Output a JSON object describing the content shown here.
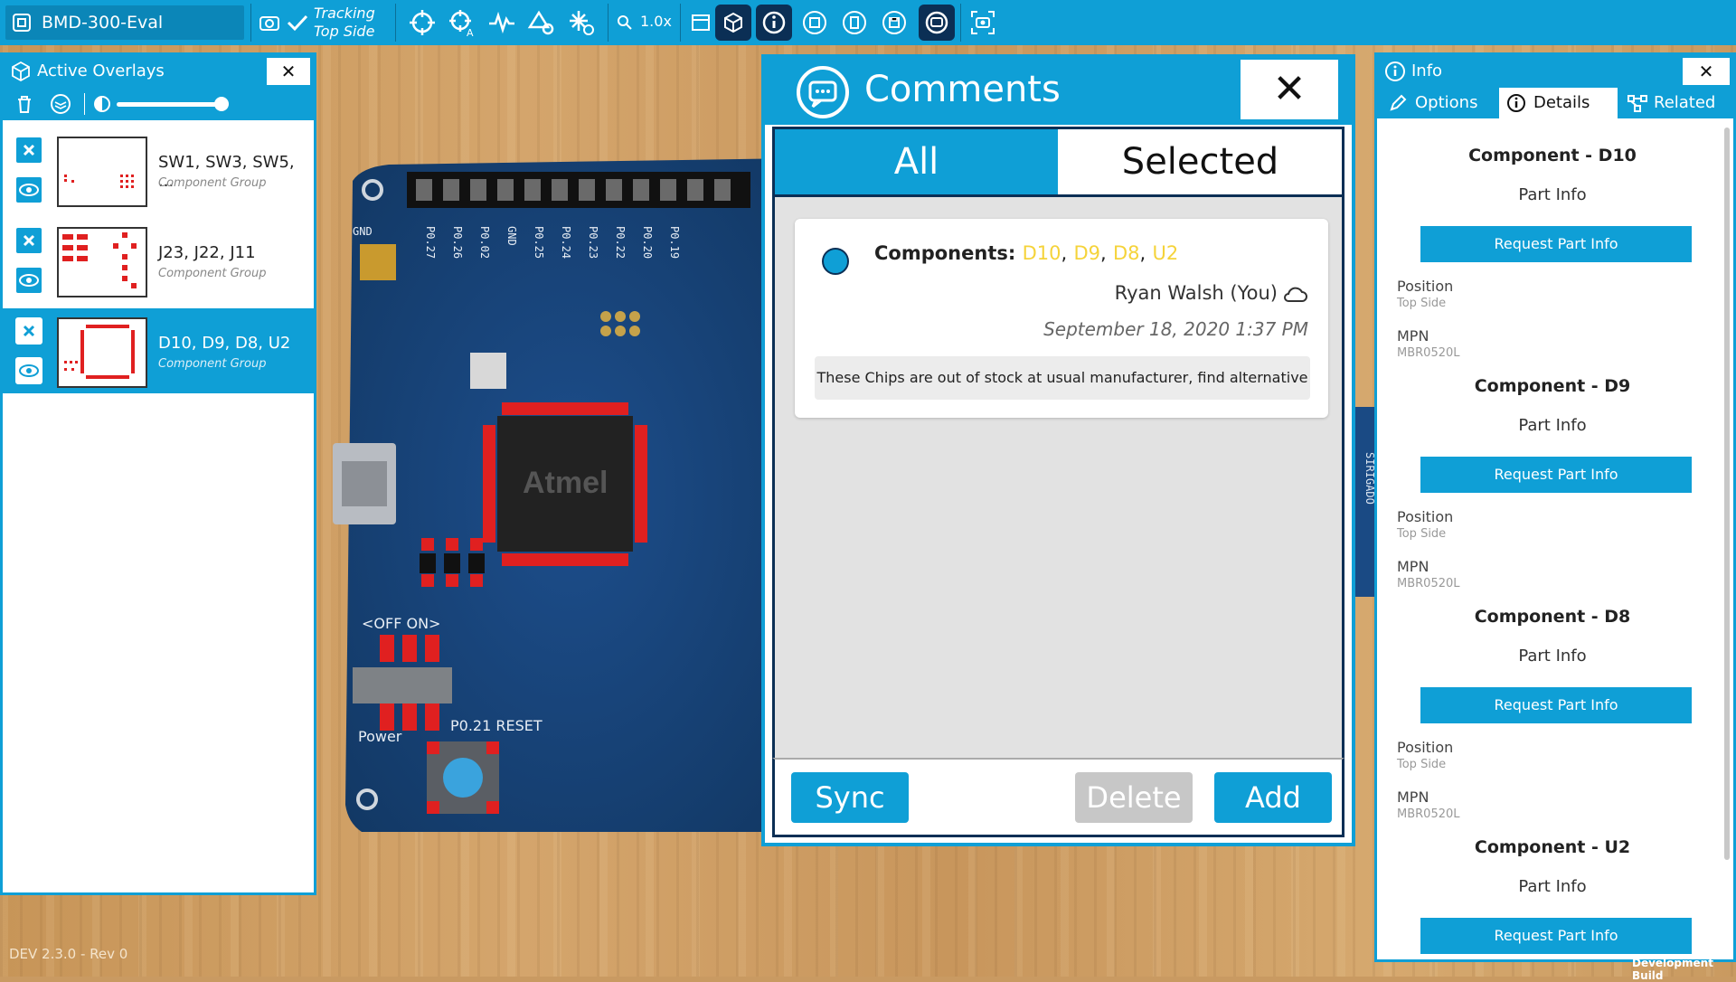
{
  "toolbar": {
    "project_name": "BMD-300-Eval",
    "tracking_line1": "Tracking",
    "tracking_line2": "Top Side",
    "zoom": "1.0x",
    "icons": [
      "board-icon",
      "camera-rotate-icon",
      "check-icon",
      "crosshair-icon",
      "crosshair-a-icon",
      "signal-icon",
      "shapes-search-icon",
      "snowflake-search-icon",
      "zoom-icon",
      "window-icon",
      "cube-icon",
      "info-icon",
      "part-icon",
      "doc-icon",
      "save-icon",
      "comment-icon",
      "screenshot-icon"
    ]
  },
  "overlays": {
    "title": "Active Overlays",
    "close": "✕",
    "items": [
      {
        "name": "SW1, SW3, SW5, ...",
        "type": "Component Group",
        "selected": false
      },
      {
        "name": "J23, J22, J11",
        "type": "Component Group",
        "selected": false
      },
      {
        "name": "D10, D9, D8, U2",
        "type": "Component Group",
        "selected": true
      }
    ]
  },
  "board_labels": {
    "gnd": "GND",
    "pins": [
      "P0.27",
      "P0.26",
      "P0.02",
      "GND",
      "P0.25",
      "P0.24",
      "P0.23",
      "P0.22",
      "P0.20",
      "P0.19"
    ],
    "chip": "Atmel",
    "off_on": "<OFF ON>",
    "power": "Power",
    "reset": "P0.21 RESET",
    "side_text": "SIRIGADO"
  },
  "comments": {
    "title": "Comments",
    "close": "✕",
    "tabs": {
      "all": "All",
      "selected": "Selected"
    },
    "entry": {
      "components_label": "Components:",
      "components": [
        "D10",
        "D9",
        "D8",
        "U2"
      ],
      "author": "Ryan Walsh (You)",
      "timestamp": "September 18, 2020 1:37 PM",
      "text": "These Chips are out of stock at usual manufacturer, find alternative"
    },
    "buttons": {
      "sync": "Sync",
      "delete": "Delete",
      "add": "Add"
    }
  },
  "info": {
    "title": "Info",
    "close": "✕",
    "tabs": {
      "options": "Options",
      "details": "Details",
      "related": "Related"
    },
    "part_info": "Part Info",
    "request_label": "Request Part Info",
    "position_label": "Position",
    "mpn_label": "MPN",
    "components": [
      {
        "title": "Component - D10",
        "position": "Top Side",
        "mpn": "MBR0520L"
      },
      {
        "title": "Component - D9",
        "position": "Top Side",
        "mpn": "MBR0520L"
      },
      {
        "title": "Component - D8",
        "position": "Top Side",
        "mpn": "MBR0520L"
      },
      {
        "title": "Component - U2"
      }
    ]
  },
  "footer": {
    "version": "DEV 2.3.0 - Rev 0",
    "build": "Development Build"
  },
  "colors": {
    "accent": "#0f9fd6",
    "dark": "#0b2f55",
    "highlight": "#e02020",
    "component_yellow": "#f5d33a"
  }
}
